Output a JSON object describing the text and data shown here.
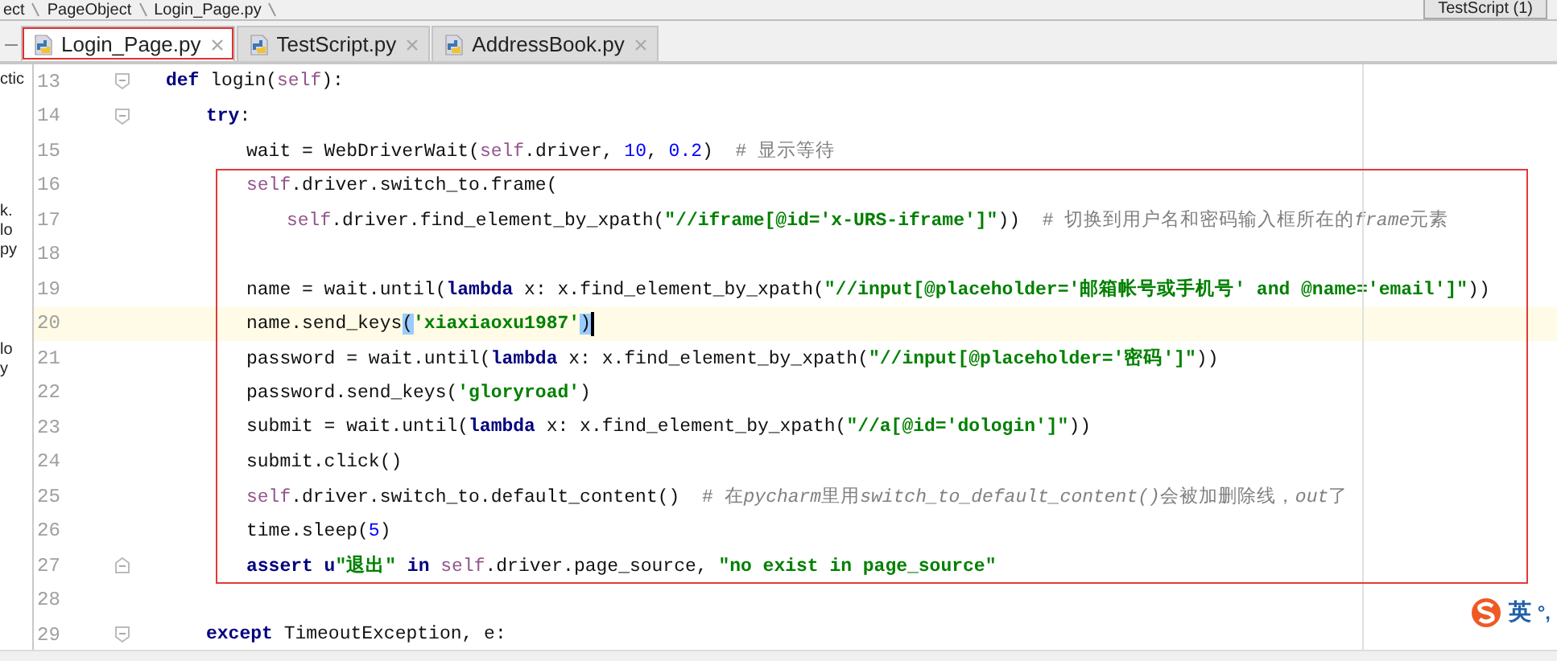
{
  "breadcrumb": {
    "items": [
      "ect",
      "PageObject",
      "Login_Page.py"
    ]
  },
  "run_config": {
    "label": "TestScript (1)"
  },
  "sidebar": {
    "items": [
      "ctic",
      "k.",
      "lo",
      "py",
      "lo",
      "y"
    ]
  },
  "tabs": [
    {
      "label": "Login_Page.py",
      "selected": true,
      "outlined": true
    },
    {
      "label": "TestScript.py",
      "selected": false,
      "outlined": false
    },
    {
      "label": "AddressBook.py",
      "selected": false,
      "outlined": false
    }
  ],
  "editor": {
    "lines": [
      {
        "kind": "block",
        "number": "13",
        "current": false,
        "tokens": [
          {
            "kind": "kw",
            "text": "def"
          },
          {
            "kind": "plain",
            "text": " login("
          },
          {
            "kind": "self",
            "text": "self"
          },
          {
            "kind": "plain",
            "text": "):"
          }
        ],
        "children": [
          {
            "kind": "block",
            "number": "14",
            "current": false,
            "tokens": [
              {
                "kind": "kw",
                "text": "try"
              },
              {
                "kind": "plain",
                "text": ":"
              }
            ],
            "children": [
              {
                "kind": "line",
                "number": "15",
                "current": false,
                "tokens": [
                  {
                    "kind": "plain",
                    "text": "wait = WebDriverWait("
                  },
                  {
                    "kind": "self",
                    "text": "self"
                  },
                  {
                    "kind": "plain",
                    "text": ".driver, "
                  },
                  {
                    "kind": "num",
                    "text": "10"
                  },
                  {
                    "kind": "plain",
                    "text": ", "
                  },
                  {
                    "kind": "num",
                    "text": "0.2"
                  },
                  {
                    "kind": "plain",
                    "text": ")  "
                  },
                  {
                    "kind": "comment",
                    "text": "# 显示等待"
                  }
                ]
              },
              {
                "kind": "annotation",
                "children": [
                  {
                    "kind": "line",
                    "number": "16",
                    "current": false,
                    "tokens": [
                      {
                        "kind": "self",
                        "text": "self"
                      },
                      {
                        "kind": "plain",
                        "text": ".driver.switch_to.frame("
                      }
                    ],
                    "children": [
                      {
                        "kind": "line",
                        "number": "17",
                        "current": false,
                        "tokens": [
                          {
                            "kind": "self",
                            "text": "self"
                          },
                          {
                            "kind": "plain",
                            "text": ".driver.find_element_by_xpath("
                          },
                          {
                            "kind": "str",
                            "text": "\"//iframe[@id='x-URS-iframe']\""
                          },
                          {
                            "kind": "plain",
                            "text": "))  "
                          },
                          {
                            "kind": "comment",
                            "text": "# 切换到用户名和密码输入框所在的"
                          },
                          {
                            "kind": "comment_italic",
                            "text": "frame"
                          },
                          {
                            "kind": "comment",
                            "text": "元素"
                          }
                        ]
                      }
                    ]
                  },
                  {
                    "kind": "line",
                    "number": "18",
                    "current": false
                  },
                  {
                    "kind": "line",
                    "number": "19",
                    "current": false,
                    "tokens": [
                      {
                        "kind": "plain",
                        "text": "name = wait.until("
                      },
                      {
                        "kind": "kw",
                        "text": "lambda"
                      },
                      {
                        "kind": "plain",
                        "text": " x: x.find_element_by_xpath("
                      },
                      {
                        "kind": "str",
                        "text": "\"//input[@placeholder='邮箱帐号或手机号' and @name='email']\""
                      },
                      {
                        "kind": "plain",
                        "text": "))"
                      }
                    ]
                  },
                  {
                    "kind": "line",
                    "number": "20",
                    "current": true,
                    "tokens": [
                      {
                        "kind": "plain",
                        "text": "name.send_keys"
                      },
                      {
                        "kind": "match",
                        "text": "("
                      },
                      {
                        "kind": "str",
                        "text": "'xiaxiaoxu1987'"
                      },
                      {
                        "kind": "match",
                        "text": ")"
                      }
                    ]
                  },
                  {
                    "kind": "line",
                    "number": "21",
                    "current": false,
                    "tokens": [
                      {
                        "kind": "plain",
                        "text": "password = wait.until("
                      },
                      {
                        "kind": "kw",
                        "text": "lambda"
                      },
                      {
                        "kind": "plain",
                        "text": " x: x.find_element_by_xpath("
                      },
                      {
                        "kind": "str",
                        "text": "\"//input[@placeholder='密码']\""
                      },
                      {
                        "kind": "plain",
                        "text": "))"
                      }
                    ]
                  },
                  {
                    "kind": "line",
                    "number": "22",
                    "current": false,
                    "tokens": [
                      {
                        "kind": "plain",
                        "text": "password.send_keys("
                      },
                      {
                        "kind": "str",
                        "text": "'gloryroad'"
                      },
                      {
                        "kind": "plain",
                        "text": ")"
                      }
                    ]
                  },
                  {
                    "kind": "line",
                    "number": "23",
                    "current": false,
                    "tokens": [
                      {
                        "kind": "plain",
                        "text": "submit = wait.until("
                      },
                      {
                        "kind": "kw",
                        "text": "lambda"
                      },
                      {
                        "kind": "plain",
                        "text": " x: x.find_element_by_xpath("
                      },
                      {
                        "kind": "str",
                        "text": "\"//a[@id='dologin']\""
                      },
                      {
                        "kind": "plain",
                        "text": "))"
                      }
                    ]
                  },
                  {
                    "kind": "line",
                    "number": "24",
                    "current": false,
                    "tokens": [
                      {
                        "kind": "plain",
                        "text": "submit.click()"
                      }
                    ]
                  },
                  {
                    "kind": "line",
                    "number": "25",
                    "current": false,
                    "tokens": [
                      {
                        "kind": "self",
                        "text": "self"
                      },
                      {
                        "kind": "plain",
                        "text": ".driver.switch_to.default_content()  "
                      },
                      {
                        "kind": "comment",
                        "text": "# 在"
                      },
                      {
                        "kind": "comment_italic",
                        "text": "pycharm"
                      },
                      {
                        "kind": "comment",
                        "text": "里用"
                      },
                      {
                        "kind": "comment_italic",
                        "text": "switch_to_default_content()"
                      },
                      {
                        "kind": "comment",
                        "text": "会被加删除线，"
                      },
                      {
                        "kind": "comment_italic",
                        "text": "out"
                      },
                      {
                        "kind": "comment",
                        "text": "了"
                      }
                    ]
                  },
                  {
                    "kind": "line",
                    "number": "26",
                    "current": false,
                    "tokens": [
                      {
                        "kind": "plain",
                        "text": "time.sleep("
                      },
                      {
                        "kind": "num",
                        "text": "5"
                      },
                      {
                        "kind": "plain",
                        "text": ")"
                      }
                    ]
                  },
                  {
                    "kind": "block_end",
                    "number": "27",
                    "current": false,
                    "tokens": [
                      {
                        "kind": "kw",
                        "text": "assert u"
                      },
                      {
                        "kind": "str",
                        "text": "\"退出\""
                      },
                      {
                        "kind": "kw",
                        "text": " in "
                      },
                      {
                        "kind": "self",
                        "text": "self"
                      },
                      {
                        "kind": "plain",
                        "text": ".driver.page_source, "
                      },
                      {
                        "kind": "str",
                        "text": "\"no exist in page_source\""
                      }
                    ]
                  }
                ]
              },
              {
                "kind": "line",
                "number": "28",
                "current": false
              }
            ]
          },
          {
            "kind": "block",
            "number": "29",
            "current": false,
            "tokens": [
              {
                "kind": "kw",
                "text": "except"
              },
              {
                "kind": "plain",
                "text": " TimeoutException, e:"
              }
            ]
          }
        ]
      }
    ]
  },
  "ime": {
    "mode": "英",
    "punct": "°,"
  }
}
